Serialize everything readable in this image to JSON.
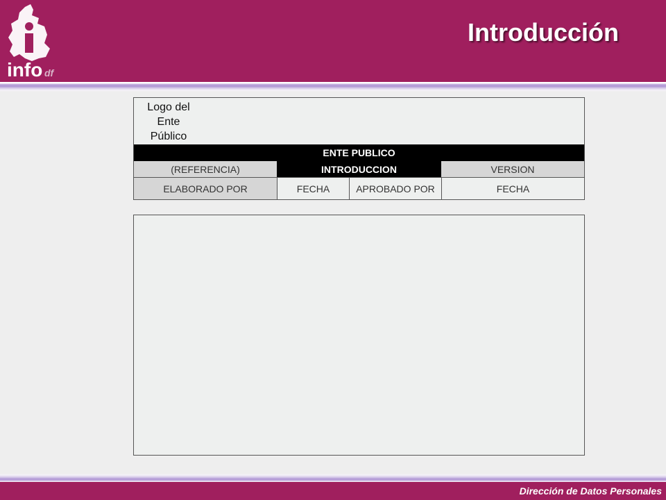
{
  "header": {
    "title": "Introducción",
    "logo_text": "info",
    "logo_subtext": "df",
    "brand_color": "#a01f5e"
  },
  "doc_table": {
    "logo_placeholder_lines": [
      "Logo del",
      "Ente",
      "Público"
    ],
    "ente_label": "ENTE PUBLICO",
    "referencia": "(REFERENCIA)",
    "section": "INTRODUCCION",
    "version": "VERSION",
    "elaborado_por": "ELABORADO POR",
    "fecha_1": "FECHA",
    "aprobado_por": "APROBADO POR",
    "fecha_2": "FECHA"
  },
  "footer": {
    "text": "Dirección de Datos Personales"
  }
}
